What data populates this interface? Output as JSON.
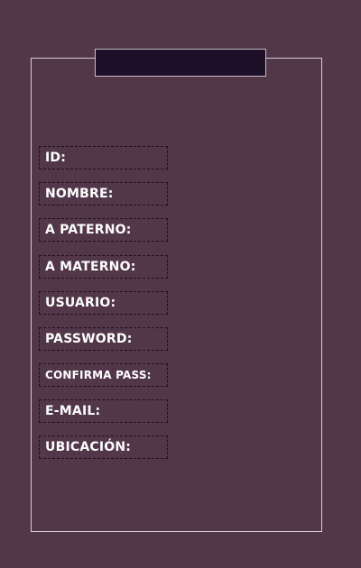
{
  "form": {
    "title": "",
    "fields": [
      {
        "label": "ID:"
      },
      {
        "label": "NOMBRE:"
      },
      {
        "label": "A PATERNO:"
      },
      {
        "label": "A MATERNO:"
      },
      {
        "label": "USUARIO:"
      },
      {
        "label": "PASSWORD:"
      },
      {
        "label": "CONFIRMA PASS:"
      },
      {
        "label": "E-MAIL:"
      },
      {
        "label": "UBICACIÓN:"
      }
    ]
  },
  "colors": {
    "background": "#523749",
    "title_bar": "#1e1028",
    "panel_border": "#d9cdd6",
    "label_border": "#1d1020",
    "label_text": "#ffffff"
  }
}
